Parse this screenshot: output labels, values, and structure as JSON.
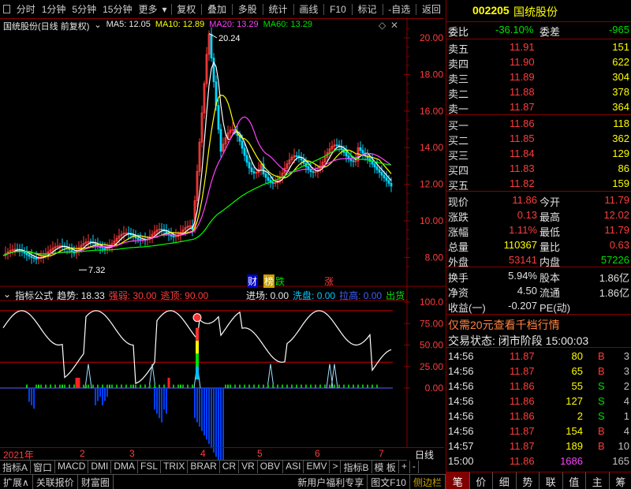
{
  "toolbar": {
    "periods": [
      "分时",
      "1分钟",
      "5分钟",
      "15分钟",
      "更多"
    ],
    "actions": [
      "复权",
      "叠加",
      "多股",
      "统计",
      "画线",
      "F10",
      "标记",
      "-自选",
      "返回"
    ]
  },
  "kline": {
    "header_title": "国统股份(日线 前复权)",
    "ma5": "MA5: 12.05",
    "ma10": "MA10: 12.89",
    "ma20": "MA20: 13.29",
    "ma60": "MA60: 13.29",
    "high_label": "20.24",
    "low_label": "7.32",
    "yaxis": [
      "20.00",
      "18.00",
      "16.00",
      "14.00",
      "12.00",
      "10.00",
      "8.00"
    ],
    "marks": [
      "财",
      "榜",
      "跌",
      "涨"
    ]
  },
  "indicator": {
    "header": "指标公式",
    "trend": "趋势: 18.33",
    "strong_weak": "强弱: 30.00",
    "escape_top": "逃顶: 90.00",
    "enter": "进场: 0.00",
    "wash": "洗盘: 0.00",
    "pull_up": "拉高: 0.00",
    "exit": "出货",
    "yaxis": [
      "100.0",
      "75.00",
      "50.00",
      "25.00",
      "0.00"
    ]
  },
  "xaxis": {
    "year": "2021年",
    "months": [
      "2",
      "3",
      "4",
      "5",
      "6",
      "7"
    ],
    "period_label": "日线"
  },
  "tabs_row1": [
    "指标A",
    "窗口",
    "MACD",
    "DMI",
    "DMA",
    "FSL",
    "TRIX",
    "BRAR",
    "CR",
    "VR",
    "OBV",
    "ASI",
    "EMV",
    ">",
    "指标B",
    "模 板",
    "+",
    "-"
  ],
  "tabs_row2": [
    "扩展∧",
    "关联报价",
    "财富圈"
  ],
  "promo": "新用户福利专享",
  "tabs_row2_right": [
    "图文F10",
    "侧边栏"
  ],
  "stock": {
    "code": "002205",
    "name": "国统股份"
  },
  "committee": {
    "ratio_label": "委比",
    "ratio": "-36.10%",
    "diff_label": "委差",
    "diff": "-965"
  },
  "asks": [
    {
      "label": "卖五",
      "price": "11.91",
      "vol": "151"
    },
    {
      "label": "卖四",
      "price": "11.90",
      "vol": "622"
    },
    {
      "label": "卖三",
      "price": "11.89",
      "vol": "304"
    },
    {
      "label": "卖二",
      "price": "11.88",
      "vol": "378"
    },
    {
      "label": "卖一",
      "price": "11.87",
      "vol": "364"
    }
  ],
  "bids": [
    {
      "label": "买一",
      "price": "11.86",
      "vol": "118"
    },
    {
      "label": "买二",
      "price": "11.85",
      "vol": "362"
    },
    {
      "label": "买三",
      "price": "11.84",
      "vol": "129"
    },
    {
      "label": "买四",
      "price": "11.83",
      "vol": "86"
    },
    {
      "label": "买五",
      "price": "11.82",
      "vol": "159"
    }
  ],
  "quote": [
    {
      "l1": "现价",
      "v1": "11.86",
      "l2": "今开",
      "v2": "11.79"
    },
    {
      "l1": "涨跌",
      "v1": "0.13",
      "l2": "最高",
      "v2": "12.02"
    },
    {
      "l1": "涨幅",
      "v1": "1.11%",
      "l2": "最低",
      "v2": "11.79"
    },
    {
      "l1": "总量",
      "v1": "110367",
      "l2": "量比",
      "v2": "0.63"
    },
    {
      "l1": "外盘",
      "v1": "53141",
      "l2": "内盘",
      "v2": "57226"
    }
  ],
  "stats": [
    {
      "l1": "换手",
      "v1": "5.94%",
      "l2": "股本",
      "v2": "1.86亿"
    },
    {
      "l1": "净资",
      "v1": "4.50",
      "l2": "流通",
      "v2": "1.86亿"
    },
    {
      "l1": "收益(一)",
      "v1": "-0.207",
      "l2": "PE(动)",
      "v2": ""
    }
  ],
  "promo_level10": "仅需20元查看千档行情",
  "trade_status": "交易状态: 闭市阶段 15:00:03",
  "ticks": [
    {
      "time": "14:56",
      "price": "11.87",
      "vol": "80",
      "bs": "B",
      "n": "3"
    },
    {
      "time": "14:56",
      "price": "11.87",
      "vol": "65",
      "bs": "B",
      "n": "3"
    },
    {
      "time": "14:56",
      "price": "11.86",
      "vol": "55",
      "bs": "S",
      "n": "2"
    },
    {
      "time": "14:56",
      "price": "11.86",
      "vol": "127",
      "bs": "S",
      "n": "4"
    },
    {
      "time": "14:56",
      "price": "11.86",
      "vol": "2",
      "bs": "S",
      "n": "1"
    },
    {
      "time": "14:56",
      "price": "11.87",
      "vol": "154",
      "bs": "B",
      "n": "4"
    },
    {
      "time": "14:57",
      "price": "11.87",
      "vol": "189",
      "bs": "B",
      "n": "10"
    },
    {
      "time": "15:00",
      "price": "11.86",
      "vol": "1686",
      "bs": "",
      "n": "165"
    }
  ],
  "bottom_nav": [
    "笔",
    "价",
    "细",
    "势",
    "联",
    "值",
    "主",
    "筹"
  ],
  "colors": {
    "up": "#ff3c3c",
    "down": "#00e000",
    "grid": "#8a0000",
    "ma5": "#ffffff",
    "ma10": "#ffff00",
    "ma20": "#ff40ff",
    "ma60": "#00ff00"
  }
}
